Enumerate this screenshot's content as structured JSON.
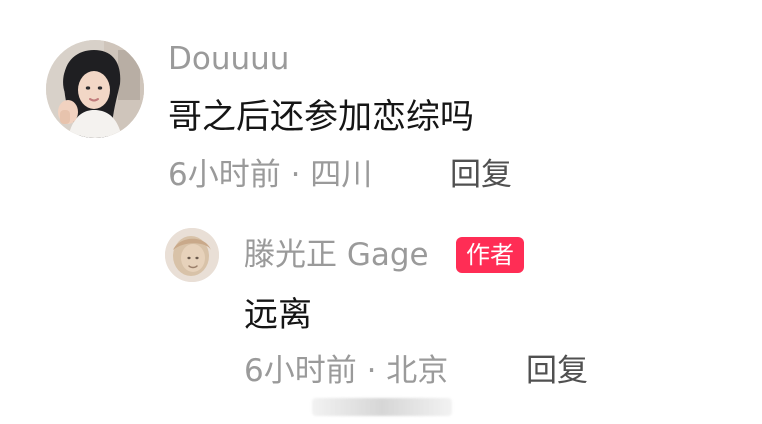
{
  "comments": [
    {
      "author": "Douuuu",
      "text": "哥之后还参加恋综吗",
      "time_location": "6小时前 · 四川",
      "reply_label": "回复"
    }
  ],
  "reply": {
    "author": "滕光正 Gage",
    "badge": "作者",
    "text": "远离",
    "time_location": "6小时前 · 北京",
    "reply_label": "回复"
  },
  "colors": {
    "badge_bg": "#ff2d55",
    "muted_text": "#9a9a9a",
    "primary_text": "#151515"
  }
}
